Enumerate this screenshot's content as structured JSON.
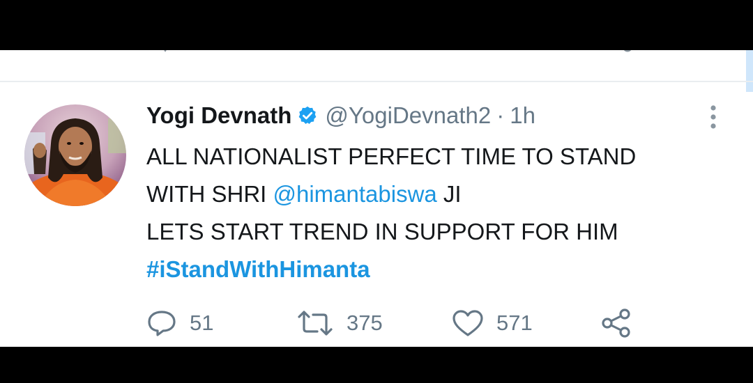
{
  "tweet": {
    "display_name": "Yogi Devnath",
    "handle": "@YogiDevnath2",
    "separator": "·",
    "time": "1h",
    "text_line1": "ALL NATIONALIST PERFECT TIME TO STAND",
    "text_line2_prefix": "WITH SHRI ",
    "mention": "@himantabiswa",
    "text_line2_suffix": " JI",
    "text_line3": "LETS START TREND IN SUPPORT FOR HIM",
    "hashtag": "#iStandWithHimanta"
  },
  "actions": {
    "replies": "51",
    "retweets": "375",
    "likes": "571"
  },
  "colors": {
    "accent": "#1b95e0",
    "secondary_text": "#657786",
    "primary_text": "#14171a",
    "verified": "#1da1f2"
  },
  "icons": [
    "verified-badge-icon",
    "more-options-icon",
    "reply-icon",
    "retweet-icon",
    "like-icon",
    "share-icon"
  ]
}
